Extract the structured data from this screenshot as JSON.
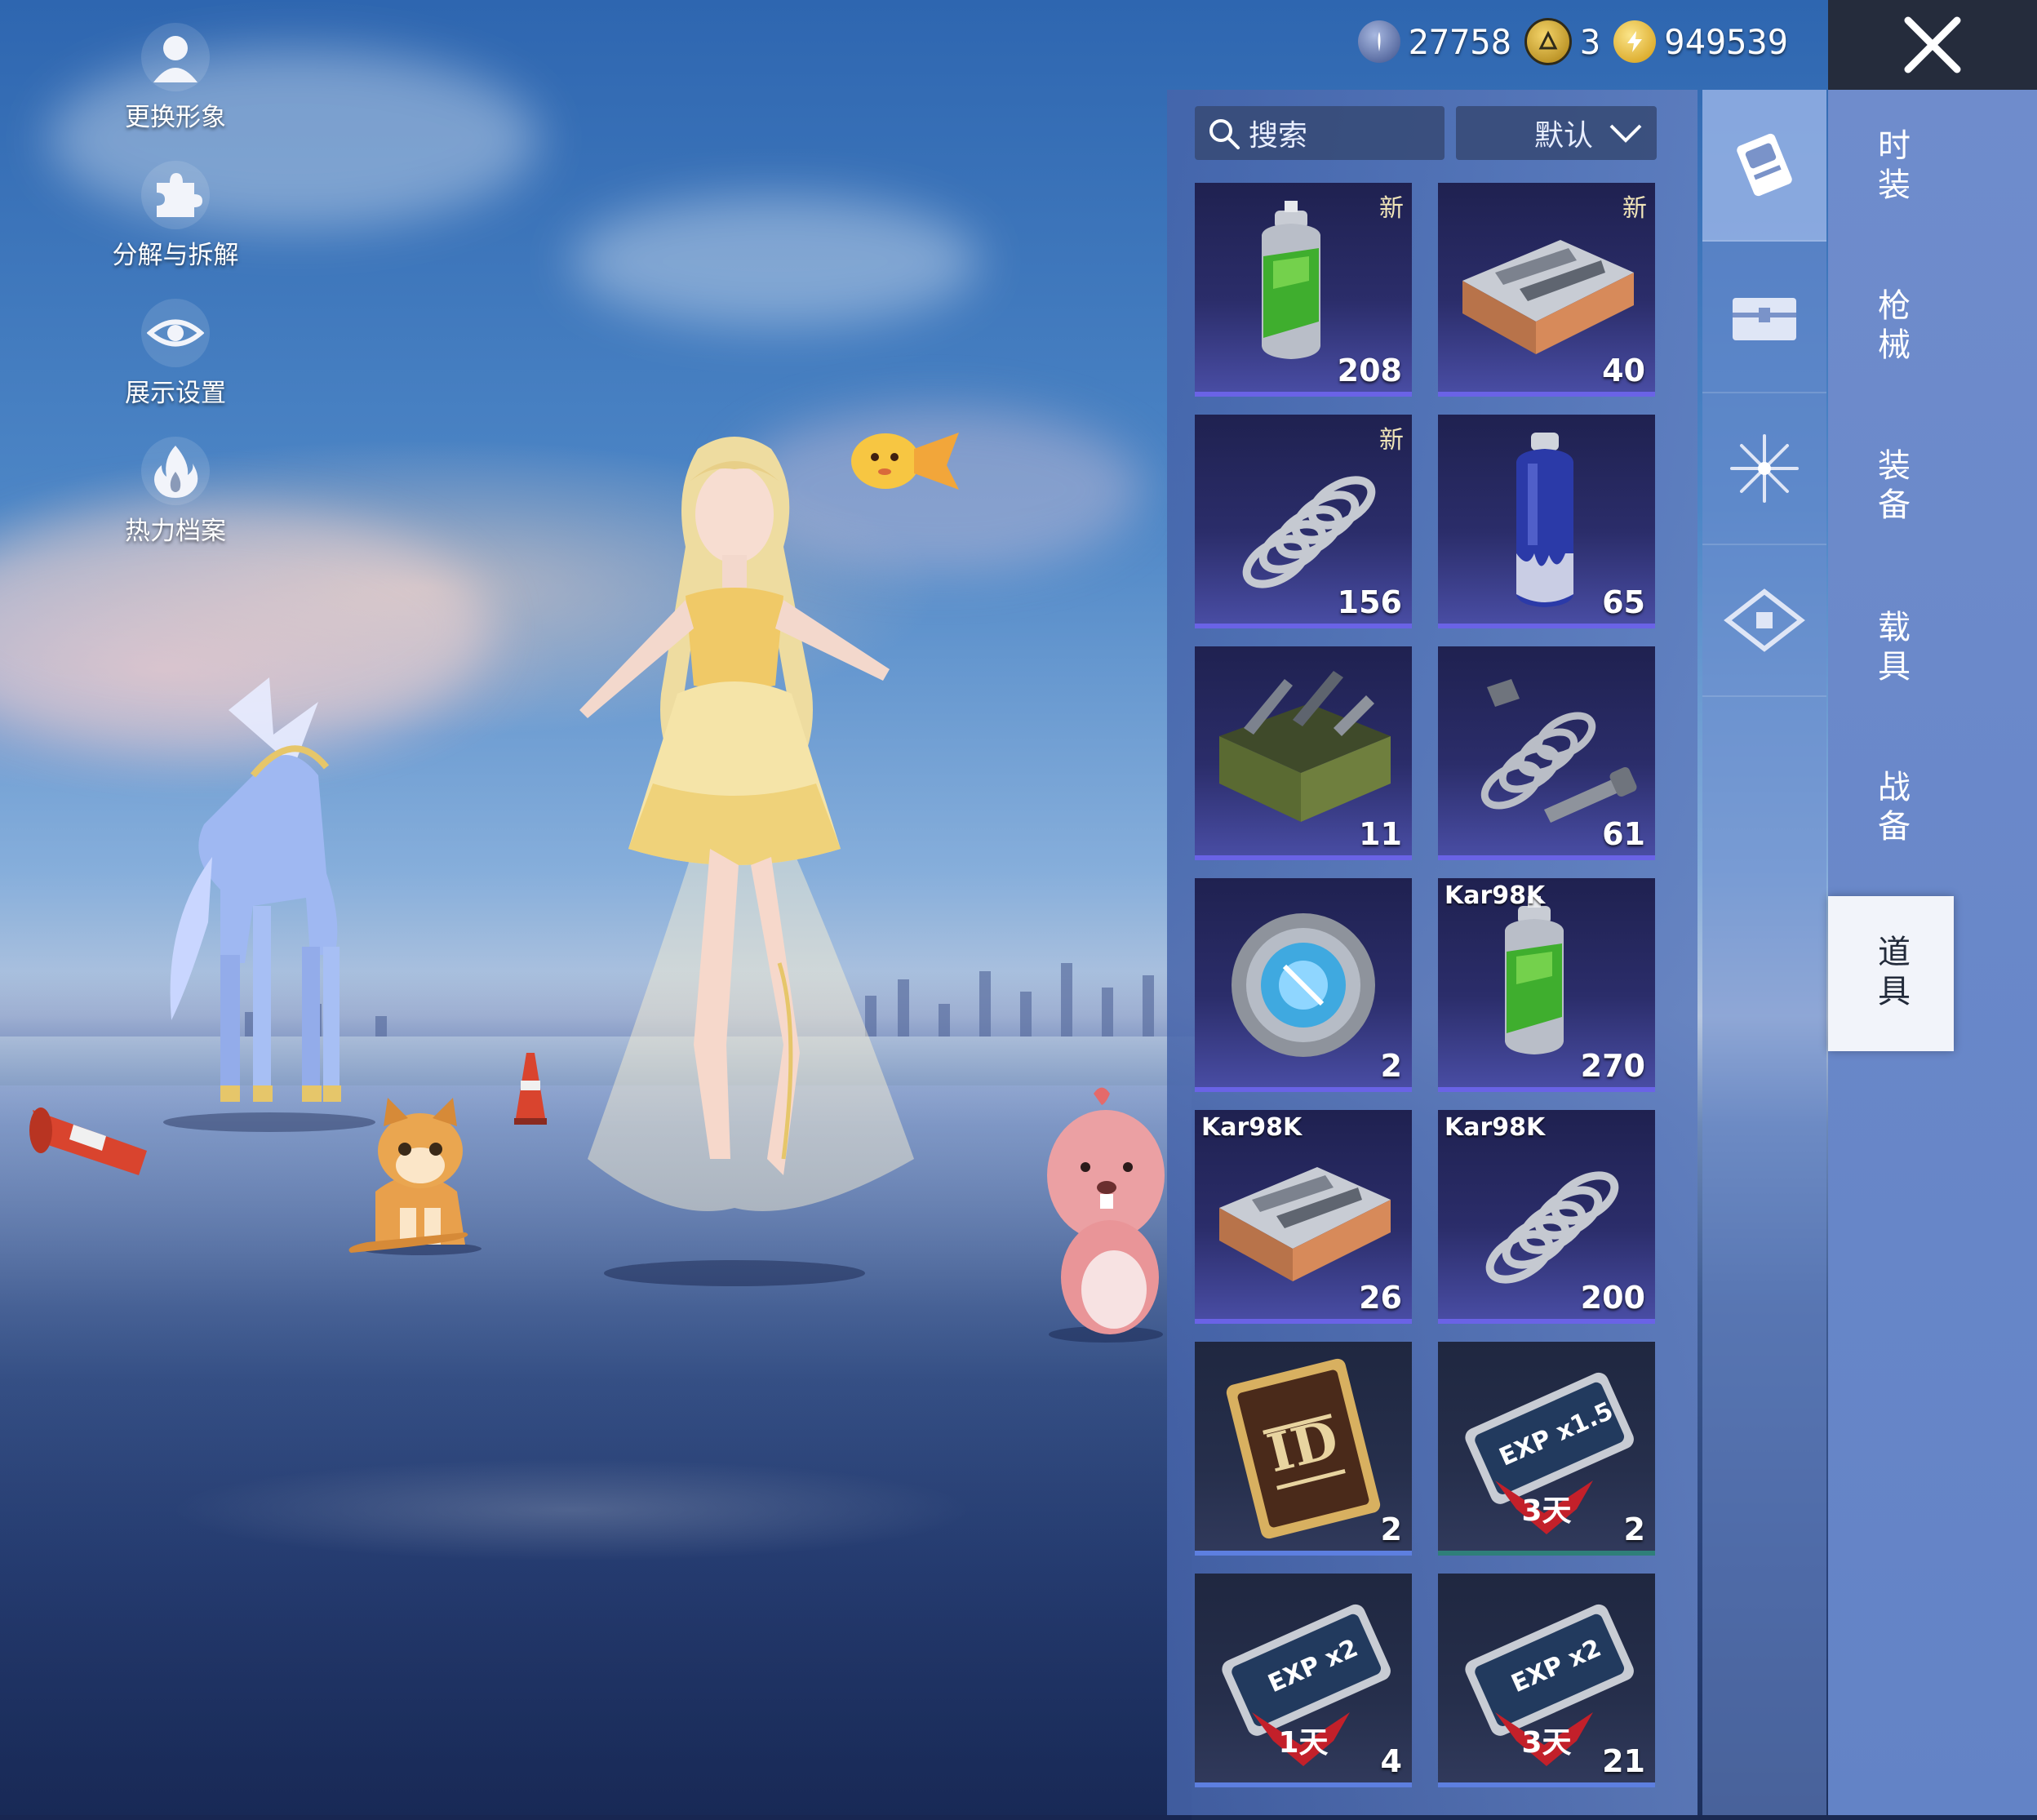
{
  "left_menu": [
    {
      "label": "更换形象",
      "icon": "person-icon"
    },
    {
      "label": "分解与拆解",
      "icon": "puzzle-icon"
    },
    {
      "label": "展示设置",
      "icon": "eye-icon"
    },
    {
      "label": "热力档案",
      "icon": "fire-icon"
    }
  ],
  "currency": [
    {
      "value": "27758",
      "icon": "silver-coin-icon",
      "color": "#3b4f8a"
    },
    {
      "value": "3",
      "icon": "gold-token-icon",
      "color": "#c79a1c"
    },
    {
      "value": "949539",
      "icon": "bp-coin-icon",
      "color": "#e3b62a"
    }
  ],
  "search": {
    "label": "搜索"
  },
  "sort": {
    "label": "默认"
  },
  "items": [
    {
      "count": "208",
      "new": "新",
      "tag": "",
      "icon": "green-spray-can-icon",
      "style": "purple"
    },
    {
      "count": "40",
      "new": "新",
      "tag": "",
      "icon": "parts-tray-icon",
      "style": "purple"
    },
    {
      "count": "156",
      "new": "新",
      "tag": "",
      "icon": "spring-icon",
      "style": "purple"
    },
    {
      "count": "65",
      "new": "",
      "tag": "",
      "icon": "blue-spray-can-icon",
      "style": "purple"
    },
    {
      "count": "11",
      "new": "",
      "tag": "",
      "icon": "tool-crate-icon",
      "style": "purple"
    },
    {
      "count": "61",
      "new": "",
      "tag": "",
      "icon": "spring-bolt-icon",
      "style": "purple"
    },
    {
      "count": "2",
      "new": "",
      "tag": "",
      "icon": "scope-disc-icon",
      "style": "purple"
    },
    {
      "count": "270",
      "new": "",
      "tag": "Kar98K",
      "icon": "green-spray-can-icon",
      "style": "purple"
    },
    {
      "count": "26",
      "new": "",
      "tag": "Kar98K",
      "icon": "parts-tray-icon",
      "style": "purple"
    },
    {
      "count": "200",
      "new": "",
      "tag": "Kar98K",
      "icon": "spring-icon",
      "style": "purple"
    },
    {
      "count": "2",
      "new": "",
      "tag": "",
      "icon": "id-card-icon",
      "style": "plain"
    },
    {
      "count": "2",
      "new": "",
      "tag": "",
      "icon": "exp-card-icon",
      "style": "teal",
      "card_text": "EXP x1.5",
      "days": "3天"
    },
    {
      "count": "4",
      "new": "",
      "tag": "",
      "icon": "exp-card-icon",
      "style": "plain",
      "card_text": "EXP x2",
      "days": "1天"
    },
    {
      "count": "21",
      "new": "",
      "tag": "",
      "icon": "exp-card-icon",
      "style": "plain",
      "card_text": "EXP x2",
      "days": "3天"
    }
  ],
  "icon_tabs": [
    {
      "icon": "card-icon"
    },
    {
      "icon": "chest-icon"
    },
    {
      "icon": "firework-icon"
    },
    {
      "icon": "ticket-icon"
    }
  ],
  "category_tabs": [
    {
      "label": "时装"
    },
    {
      "label": "枪械"
    },
    {
      "label": "装备"
    },
    {
      "label": "载具"
    },
    {
      "label": "战备"
    },
    {
      "label": "道具"
    }
  ],
  "close": {
    "icon": "close-icon"
  }
}
